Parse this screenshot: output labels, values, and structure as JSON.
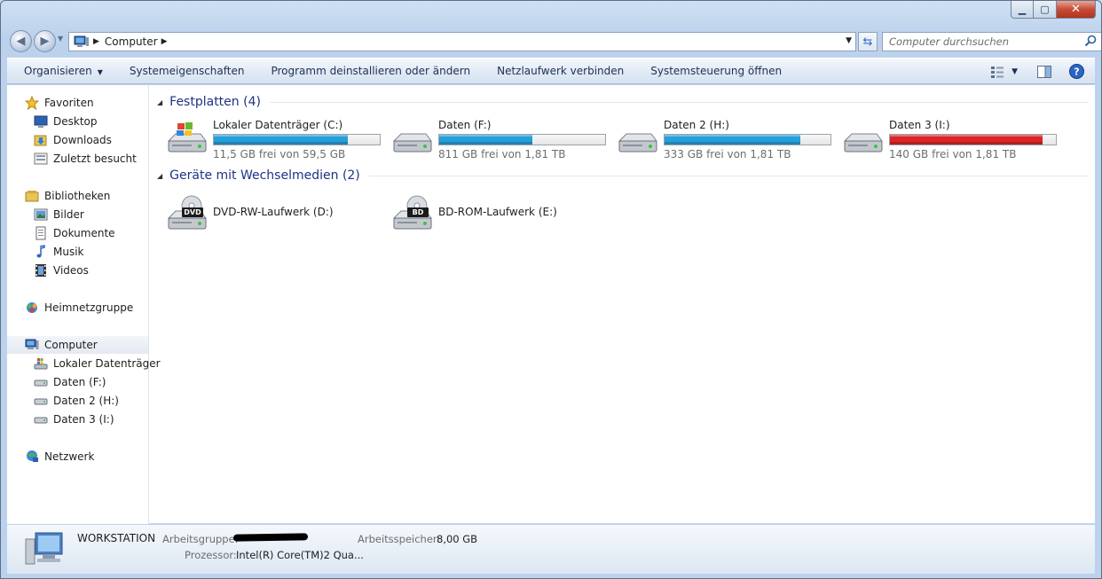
{
  "window": {
    "controls": {
      "minimize": "▁",
      "maximize": "▢",
      "close": "✕"
    }
  },
  "nav": {
    "address_crumb": "Computer",
    "search_placeholder": "Computer durchsuchen"
  },
  "toolbar": {
    "items": [
      {
        "label": "Organisieren",
        "dropdown": true
      },
      {
        "label": "Systemeigenschaften"
      },
      {
        "label": "Programm deinstallieren oder ändern"
      },
      {
        "label": "Netzlaufwerk verbinden"
      },
      {
        "label": "Systemsteuerung öffnen"
      }
    ]
  },
  "sidebar": {
    "favorites": {
      "label": "Favoriten",
      "items": [
        "Desktop",
        "Downloads",
        "Zuletzt besucht"
      ]
    },
    "libraries": {
      "label": "Bibliotheken",
      "items": [
        "Bilder",
        "Dokumente",
        "Musik",
        "Videos"
      ]
    },
    "homegroup": {
      "label": "Heimnetzgruppe"
    },
    "computer": {
      "label": "Computer",
      "items": [
        "Lokaler Datenträger",
        "Daten (F:)",
        "Daten 2 (H:)",
        "Daten 3 (I:)"
      ]
    },
    "network": {
      "label": "Netzwerk"
    }
  },
  "groups": {
    "hdd": {
      "title": "Festplatten (4)"
    },
    "removable": {
      "title": "Geräte mit Wechselmedien (2)"
    }
  },
  "drives": [
    {
      "name": "Lokaler Datenträger (C:)",
      "free": "11,5 GB frei von 59,5 GB",
      "used_fraction": 0.81,
      "color": "#26a0da"
    },
    {
      "name": "Daten (F:)",
      "free": "811 GB frei von 1,81 TB",
      "used_fraction": 0.56,
      "color": "#26a0da"
    },
    {
      "name": "Daten 2 (H:)",
      "free": "333 GB frei von 1,81 TB",
      "used_fraction": 0.82,
      "color": "#26a0da"
    },
    {
      "name": "Daten 3 (I:)",
      "free": "140 GB frei von 1,81 TB",
      "used_fraction": 0.92,
      "color": "#da2626"
    }
  ],
  "optical": [
    {
      "name": "DVD-RW-Laufwerk (D:)",
      "badge": "DVD"
    },
    {
      "name": "BD-ROM-Laufwerk (E:)",
      "badge": "BD"
    }
  ],
  "details": {
    "computer_name": "WORKSTATION",
    "workgroup_label": "Arbeitsgruppe:",
    "memory_label": "Arbeitsspeicher:",
    "memory_value": "8,00 GB",
    "processor_label": "Prozessor:",
    "processor_value": "Intel(R) Core(TM)2 Qua..."
  }
}
